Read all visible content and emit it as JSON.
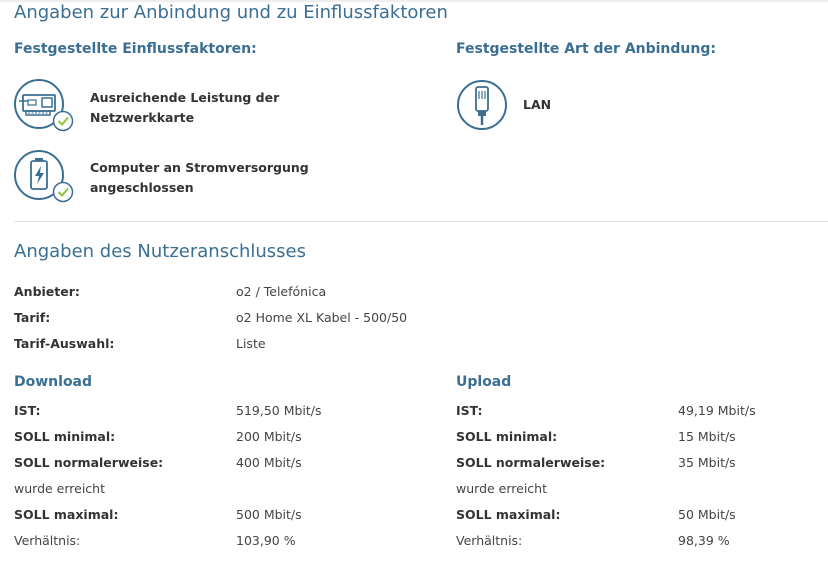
{
  "section1": {
    "title": "Angaben zur Anbindung und zu Einflussfaktoren",
    "factors_heading": "Festgestellte Einflussfaktoren:",
    "factors": [
      {
        "icon": "network-card-icon",
        "line1": "Ausreichende Leistung der",
        "line2": "Netzwerkkarte"
      },
      {
        "icon": "battery-plug-icon",
        "line1": "Computer an Stromversorgung",
        "line2": "angeschlossen"
      }
    ],
    "connection_heading": "Festgestellte Art der Anbindung:",
    "connection": {
      "icon": "lan-cable-icon",
      "label": "LAN"
    }
  },
  "section2": {
    "title": "Angaben des Nutzeranschlusses",
    "info": [
      {
        "label": "Anbieter:",
        "value": "o2 / Telefónica"
      },
      {
        "label": "Tarif:",
        "value": "o2 Home XL Kabel - 500/50"
      },
      {
        "label": "Tarif-Auswahl:",
        "value": "Liste"
      }
    ],
    "download": {
      "heading": "Download",
      "ist_label": "IST:",
      "ist_value": "519,50 Mbit/s",
      "soll_min_label": "SOLL minimal:",
      "soll_min_value": "200 Mbit/s",
      "soll_norm_label": "SOLL normalerweise:",
      "soll_norm_value": "400 Mbit/s",
      "reached": "wurde erreicht",
      "soll_max_label": "SOLL maximal:",
      "soll_max_value": "500 Mbit/s",
      "ratio_label": "Verhältnis:",
      "ratio_value": "103,90 %"
    },
    "upload": {
      "heading": "Upload",
      "ist_label": "IST:",
      "ist_value": "49,19 Mbit/s",
      "soll_min_label": "SOLL minimal:",
      "soll_min_value": "15 Mbit/s",
      "soll_norm_label": "SOLL normalerweise:",
      "soll_norm_value": "35 Mbit/s",
      "reached": "wurde erreicht",
      "soll_max_label": "SOLL maximal:",
      "soll_max_value": "50 Mbit/s",
      "ratio_label": "Verhältnis:",
      "ratio_value": "98,39 %"
    }
  },
  "colors": {
    "heading": "#3a6f93",
    "icon_stroke": "#3a6f93",
    "check": "#8cc63f"
  }
}
